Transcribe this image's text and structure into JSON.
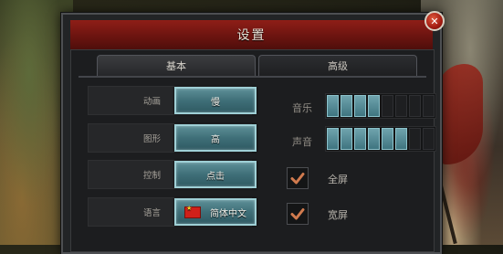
{
  "dialog": {
    "title": "设置",
    "tabs": [
      {
        "label": "基本",
        "active": true
      },
      {
        "label": "高级",
        "active": false
      }
    ]
  },
  "settings": [
    {
      "label": "动画",
      "value": "慢"
    },
    {
      "label": "图形",
      "value": "高"
    },
    {
      "label": "控制",
      "value": "点击"
    },
    {
      "label": "语言",
      "value": "简体中文"
    }
  ],
  "audio": [
    {
      "label": "音乐",
      "level": 4,
      "max": 8
    },
    {
      "label": "声音",
      "level": 6,
      "max": 8
    }
  ],
  "display_options": [
    {
      "label": "全屏",
      "checked": true
    },
    {
      "label": "宽屏",
      "checked": true
    }
  ],
  "colors": {
    "title_bar": "#7a1a14",
    "button_teal": "#4a7e87",
    "check_accent": "#d07a4e"
  },
  "icons": {
    "close": "close-icon",
    "check": "checkmark-icon",
    "flag": "china-flag-icon"
  }
}
